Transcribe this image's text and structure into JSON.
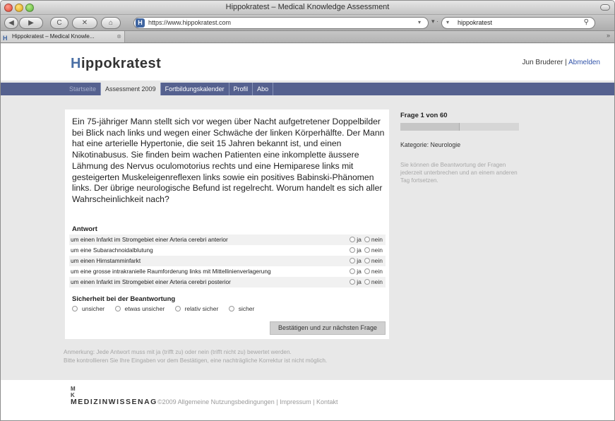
{
  "window": {
    "title": "Hippokratest – Medical Knowledge Assessment"
  },
  "toolbar": {
    "back_label": "◀",
    "forward_label": "▶",
    "reload_label": "C",
    "stop_label": "✕",
    "home_label": "⌂",
    "address_url": "https://www.hippokratest.com",
    "favicon_letter": "H",
    "search_value": "hippokratest"
  },
  "tab": {
    "label": "Hippokratest – Medical Knowle..."
  },
  "header": {
    "logo_h": "H",
    "logo_rest": "ippokratest",
    "user_name": "Jun Bruderer",
    "separator": "|",
    "logout_label": "Abmelden"
  },
  "nav": {
    "items": [
      {
        "label": "Startseite"
      },
      {
        "label": "Assessment 2009"
      },
      {
        "label": "Fortbildungskalender"
      },
      {
        "label": "Profil"
      },
      {
        "label": "Abo"
      }
    ]
  },
  "question": {
    "text": "Ein 75-jähriger Mann stellt sich vor wegen über Nacht aufgetretener Doppelbilder bei Blick nach links und wegen einer Schwäche der linken Körperhälfte. Der Mann hat eine arterielle Hypertonie, die seit 15 Jahren bekannt ist, und einen Nikotinabusus. Sie finden beim wachen Patienten eine inkomplette äussere Lähmung des Nervus oculomotorius rechts und eine Hemiparese links mit gesteigerten Muskeleigenreflexen links sowie ein positives Babinski-Phänomen links. Der übrige neurologische Befund ist regelrecht. Worum handelt es sich aller Wahrscheinlichkeit nach?",
    "answers_title": "Antwort",
    "yes_label": "ja",
    "no_label": "nein",
    "answers": [
      {
        "label": "um einen Infarkt im Stromgebiet einer Arteria cerebri anterior"
      },
      {
        "label": "um eine Subarachnoidalblutung"
      },
      {
        "label": "um einen Hirnstamminfarkt"
      },
      {
        "label": "um eine grosse intrakranielle Raumforderung links mit Mittellinienverlagerung"
      },
      {
        "label": "um einen Infarkt im Stromgebiet einer Arteria cerebri posterior"
      }
    ],
    "certainty_title": "Sicherheit bei der Beantwortung",
    "certainty_options": [
      {
        "label": "unsicher"
      },
      {
        "label": "etwas unsicher"
      },
      {
        "label": "relativ sicher"
      },
      {
        "label": "sicher"
      }
    ],
    "confirm_label": "Bestätigen und zur nächsten Frage"
  },
  "sidebar": {
    "progress_title": "Frage 1 von 60",
    "progress_fraction": 0.5,
    "category": "Kategorie: Neurologie",
    "note": "Sie können die Beantwortung der Fragen jederzeit unterbrechen und an einem anderen Tag fortsetzen."
  },
  "remark": {
    "line1": "Anmerkung: Jede Antwort muss mit ja (trifft zu) oder nein (trifft nicht zu) bewertet werden.",
    "line2": "Bitte kontrollieren Sie Ihre Eingaben vor dem Bestätigen, eine nachträgliche Korrektur ist nicht möglich."
  },
  "footer": {
    "mk_m": "M",
    "mk_k": "K",
    "brand": "MEDIZINWISSENAG",
    "links": "©2009  Allgemeine Nutzungsbedingungen | Impressum | Kontakt"
  }
}
